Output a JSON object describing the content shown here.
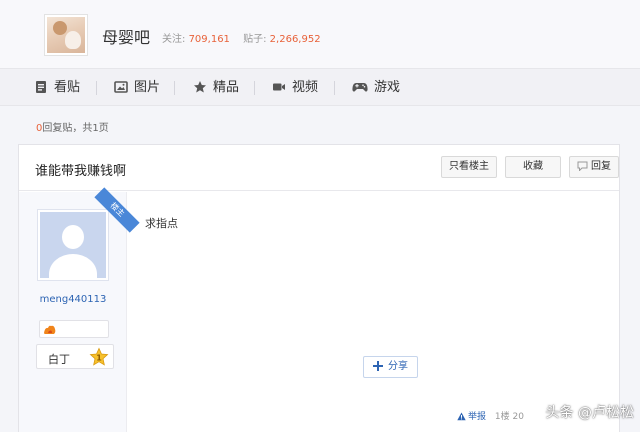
{
  "forum": {
    "name": "母婴吧",
    "follow_label": "关注:",
    "follow_count": "709,161",
    "posts_label": "贴子:",
    "posts_count": "2,266,952"
  },
  "nav": {
    "items": [
      {
        "label": "看贴",
        "icon": "document-icon"
      },
      {
        "label": "图片",
        "icon": "image-icon"
      },
      {
        "label": "精品",
        "icon": "star-icon"
      },
      {
        "label": "视频",
        "icon": "video-icon"
      },
      {
        "label": "游戏",
        "icon": "gamepad-icon"
      }
    ]
  },
  "reply_info": {
    "count": "0",
    "text": "回复贴，共1页"
  },
  "post": {
    "title": "谁能带我赚钱啊",
    "buttons": {
      "only_op": "只看楼主",
      "favorite": "收藏",
      "reply": "回复"
    },
    "author": {
      "badge": "楼主",
      "username": "meng440113",
      "rank": "白丁",
      "level": "1"
    },
    "content": "求指点",
    "share_label": "分享",
    "footer": {
      "report": "举报",
      "floor": "1楼",
      "date_partial": "20"
    }
  },
  "watermark": "头条 @卢松松",
  "colors": {
    "accent_orange": "#e8623a",
    "link_blue": "#2d64b3",
    "ribbon_blue": "#4a87d8"
  }
}
